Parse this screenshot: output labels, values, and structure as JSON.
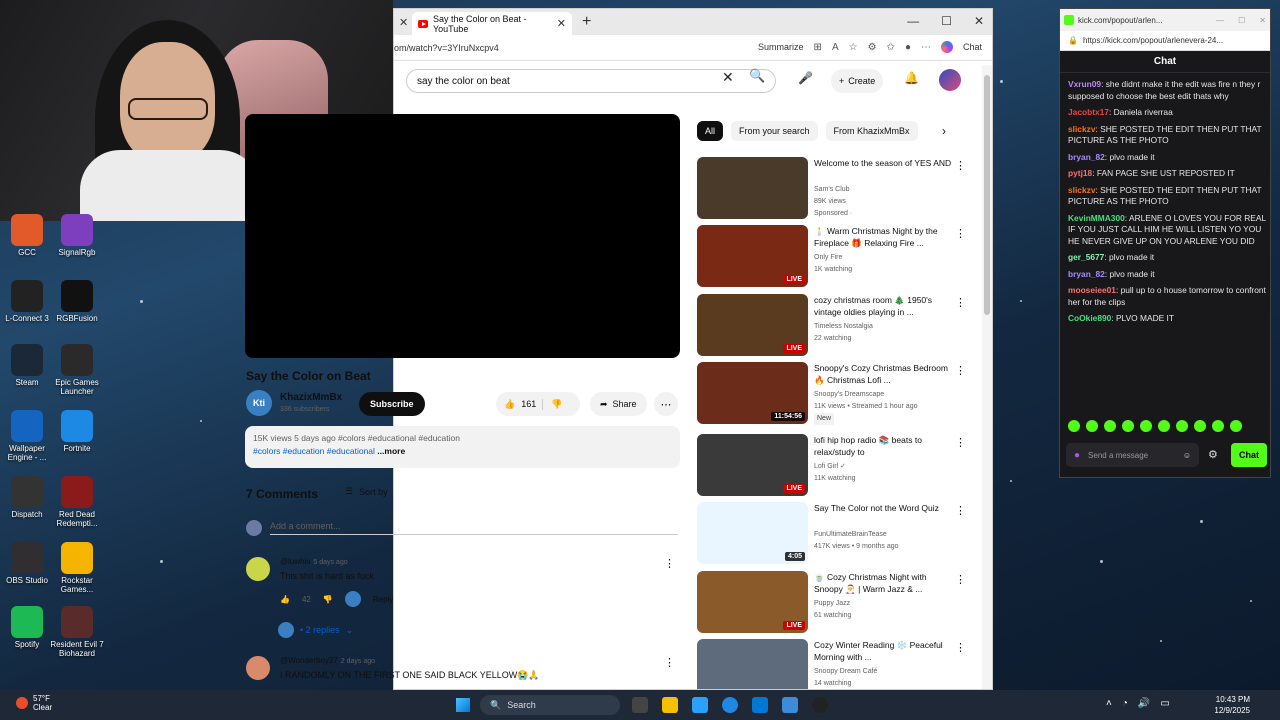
{
  "browser": {
    "tab_title": "Say the Color on Beat - YouTube",
    "url": "om/watch?v=3YIruNxcpv4",
    "summarize_label": "Summarize",
    "chat_label": "Chat"
  },
  "youtube": {
    "search_value": "say the color on beat",
    "create_label": "Create",
    "video_title": "Say the Color on Beat",
    "channel_name": "KhazixMmBx",
    "channel_avatar_text": "Kti",
    "subscribers": "336 subscribers",
    "subscribe_label": "Subscribe",
    "likes": "161",
    "share_label": "Share",
    "description_line1": "15K views  5 days ago  #colors #educational #education",
    "description_line2": "#colors #education #educational",
    "more_label": "...more",
    "comments_heading": "7 Comments",
    "sort_label": "Sort by",
    "add_comment_placeholder": "Add a comment...",
    "comments": [
      {
        "user": "@luwhis",
        "time": "5 days ago",
        "text": "This shit is hard as fuck",
        "likes": "42",
        "reply_label": "Reply",
        "replies_label": "• 2 replies"
      },
      {
        "user": "@Wonderboy27",
        "time": "2 days ago",
        "text": "I RANDOMLY ON THE FIRST ONE SAID BLACK YELLOW😭🙏"
      }
    ],
    "chips": [
      "All",
      "From your search",
      "From KhazixMmBx"
    ],
    "recommendations": [
      {
        "title": "Welcome to the season of YES AND",
        "channel": "Sam's Club",
        "meta": "89K views",
        "extra": "Sponsored ·",
        "badge": ""
      },
      {
        "title": "🕯️ Warm Christmas Night by the Fireplace 🎁 Relaxing Fire ...",
        "channel": "Only Fire",
        "meta": "1K watching",
        "extra": "",
        "badge": "LIVE"
      },
      {
        "title": "cozy christmas room 🎄 1950's vintage oldies playing in ...",
        "channel": "Timeless Nostalgia",
        "meta": "22 watching",
        "extra": "",
        "badge": "LIVE"
      },
      {
        "title": "Snoopy's Cozy Christmas Bedroom 🔥 Christmas Lofi ...",
        "channel": "Snoopy's Dreamscape",
        "meta": "11K views • Streamed 1 hour ago",
        "extra": "New",
        "badge": "11:54:56"
      },
      {
        "title": "lofi hip hop radio 📚 beats to relax/study to",
        "channel": "Lofi Girl ✓",
        "meta": "11K watching",
        "extra": "",
        "badge": "LIVE"
      },
      {
        "title": "Say The Color not the Word Quiz",
        "channel": "FunUltimateBrainTease",
        "meta": "417K views • 9 months ago",
        "extra": "",
        "badge": "4:05"
      },
      {
        "title": "🍵 Cozy Christmas Night with Snoopy 🎅 | Warm Jazz & ...",
        "channel": "Puppy Jazz",
        "meta": "61 watching",
        "extra": "",
        "badge": "LIVE"
      },
      {
        "title": "Cozy Winter Reading ❄️ Peaceful Morning with ...",
        "channel": "Snoopy Dream Café",
        "meta": "14 watching",
        "extra": "",
        "badge": "LIVE"
      }
    ]
  },
  "kick": {
    "window_title": "kick.com/popout/arlen...",
    "url": "https://kick.com/popout/arlenevera-24...",
    "chat_heading": "Chat",
    "messages": [
      {
        "user": "Vxrun09",
        "color": "#c084fc",
        "text": "she didnt make it the edit was fire n they r supposed to choose the best edit thats why"
      },
      {
        "user": "Jacobtx17",
        "color": "#ef4444",
        "text": "Daniela riverraa"
      },
      {
        "user": "slickzv",
        "color": "#f97316",
        "text": "SHE POSTED THE EDIT THEN PUT THAT PICTURE AS THE PHOTO"
      },
      {
        "user": "bryan_82",
        "color": "#a78bfa",
        "text": "plvo made it"
      },
      {
        "user": "pytj18",
        "color": "#f87171",
        "text": "FAN PAGE SHE UST REPOSTED IT"
      },
      {
        "user": "slickzv",
        "color": "#f97316",
        "text": "SHE POSTED THE EDIT THEN PUT THAT PICTURE AS THE PHOTO"
      },
      {
        "user": "KevinMMA300",
        "color": "#4ade80",
        "text": "ARLENE O LOVES YOU FOR REAL IF YOU JUST CALL HIM HE WILL LISTEN YO YOU HE NEVER GIVE UP ON YOU ARLENE YOU DID"
      },
      {
        "user": "ger_5677",
        "color": "#86efac",
        "text": "plvo made it"
      },
      {
        "user": "bryan_82",
        "color": "#a78bfa",
        "text": "plvo made it"
      },
      {
        "user": "mooseiee01",
        "color": "#f87171",
        "text": "pull up to o house tomorrow to confront her for the clips"
      },
      {
        "user": "CoOkie890",
        "color": "#4ade80",
        "text": "PLVO MADE IT"
      }
    ],
    "input_placeholder": "Send a message",
    "chat_button": "Chat"
  },
  "desktop_icons": [
    {
      "label": "GCC",
      "color": "#e35a2a"
    },
    {
      "label": "SignalRgb",
      "color": "#7e3fbf"
    },
    {
      "label": "L-Connect 3",
      "color": "#222"
    },
    {
      "label": "RGBFusion",
      "color": "#111"
    },
    {
      "label": "Steam",
      "color": "#1b2838"
    },
    {
      "label": "Epic Games Launcher",
      "color": "#2a2a2a"
    },
    {
      "label": "Wallpaper Engine - ...",
      "color": "#1565c0"
    },
    {
      "label": "Fortnite",
      "color": "#1e88e5"
    },
    {
      "label": "Dispatch",
      "color": "#333"
    },
    {
      "label": "Red Dead Redempti...",
      "color": "#8b1a1a"
    },
    {
      "label": "OBS Studio",
      "color": "#302e31"
    },
    {
      "label": "Rockstar Games...",
      "color": "#f5b400"
    },
    {
      "label": "Spotify",
      "color": "#1db954"
    },
    {
      "label": "Resident Evil 7 Biohazard",
      "color": "#5a2b2b"
    }
  ],
  "taskbar": {
    "temp": "57°F",
    "condition": "Clear",
    "search_label": "Search",
    "time": "10:43 PM",
    "date": "12/9/2025"
  }
}
